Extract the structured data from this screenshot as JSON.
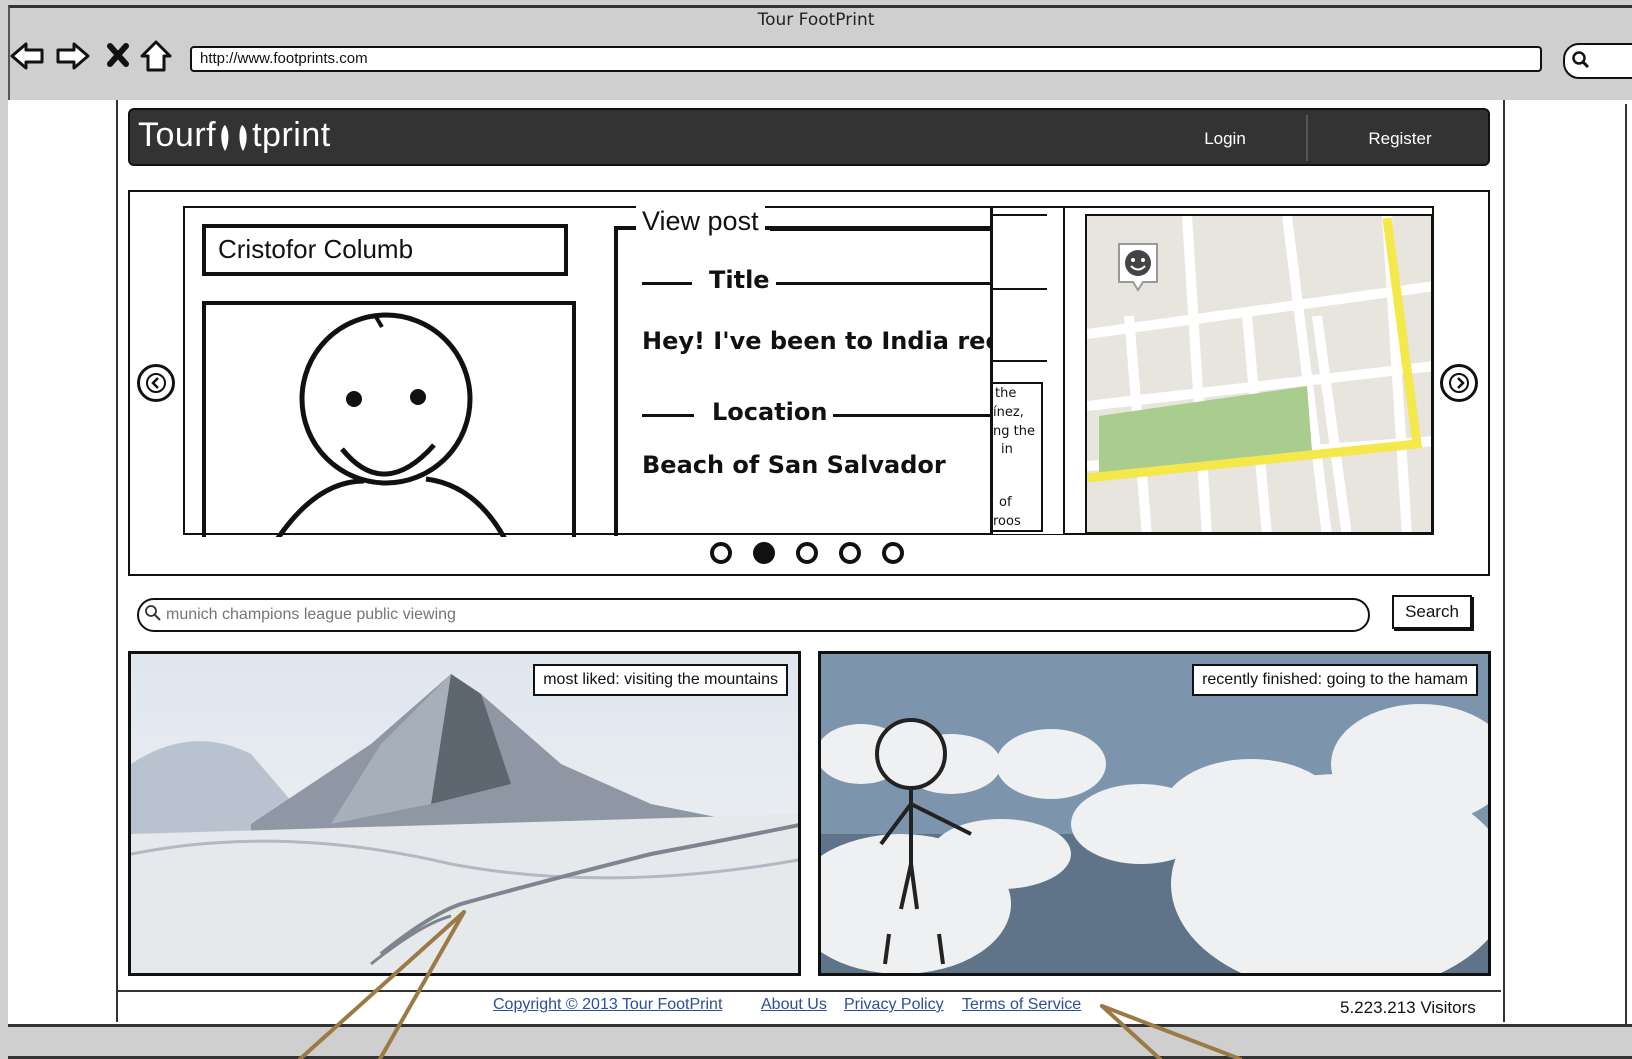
{
  "browser": {
    "window_title": "Tour FootPrint",
    "url": "http://www.footprints.com",
    "nav_icons": [
      "back-arrow-icon",
      "forward-arrow-icon",
      "stop-icon",
      "home-icon"
    ]
  },
  "header": {
    "logo_prefix": "Tourf",
    "logo_suffix": "tprint",
    "login_label": "Login",
    "register_label": "Register"
  },
  "carousel": {
    "author": "Cristofor Columb",
    "post_legend": "View post",
    "title_label": "Title",
    "post_text": "Hey! I've been to India rec",
    "location_label": "Location",
    "location_value": "Beach of San Salvador",
    "overlay_fragments": [
      "the",
      "ínez,",
      "ng the",
      "in",
      "of",
      "roos"
    ],
    "dots_total": 5,
    "active_dot": 2
  },
  "search": {
    "placeholder": "munich champions league public viewing",
    "button_label": "Search"
  },
  "tiles": [
    {
      "label": "most liked: visiting the mountains"
    },
    {
      "label": "recently finished: going to the hamam"
    }
  ],
  "footer": {
    "copyright": "Copyright © 2013 Tour FootPrint",
    "about": "About Us",
    "privacy": "Privacy Policy",
    "terms": "Terms of Service",
    "visitors": "5.223.213 Visitors"
  },
  "colors": {
    "header_bg": "#333333",
    "link": "#2a4f97",
    "map_road_highlight": "#f4e84a",
    "map_park": "#a9cc8f",
    "annotation": "#9b7a45"
  }
}
